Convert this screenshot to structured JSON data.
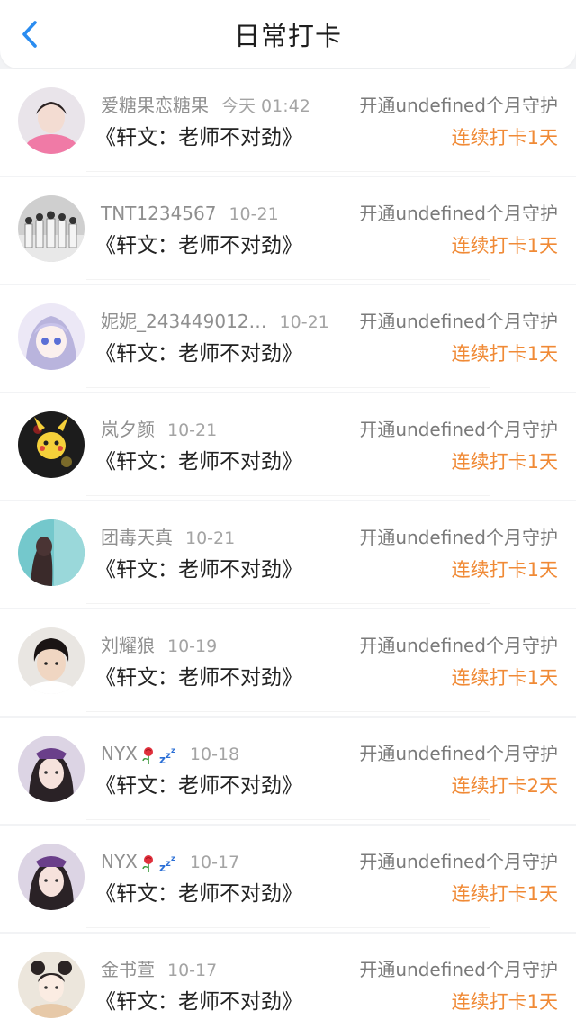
{
  "header": {
    "title": "日常打卡",
    "back_icon": "chevron-left-icon",
    "accent_color": "#2a8cf0"
  },
  "colors": {
    "streak": "#f08a36",
    "muted_text": "#8f8f8f"
  },
  "records": [
    {
      "user": "爱糖果恋糖果",
      "date": "今天 01:42",
      "book": "《轩文：老师不对劲》",
      "subscribe": "开通undefined个月守护",
      "streak": "连续打卡1天",
      "avatar": "avatar-pink",
      "name_icons": []
    },
    {
      "user": "TNT1234567",
      "date": "10-21",
      "book": "《轩文：老师不对劲》",
      "subscribe": "开通undefined个月守护",
      "streak": "连续打卡1天",
      "avatar": "avatar-group",
      "name_icons": []
    },
    {
      "user": "妮妮_243449012…",
      "date": "10-21",
      "book": "《轩文：老师不对劲》",
      "subscribe": "开通undefined个月守护",
      "streak": "连续打卡1天",
      "avatar": "avatar-anime",
      "name_icons": []
    },
    {
      "user": "岚夕颜",
      "date": "10-21",
      "book": "《轩文：老师不对劲》",
      "subscribe": "开通undefined个月守护",
      "streak": "连续打卡1天",
      "avatar": "avatar-pikachu",
      "name_icons": []
    },
    {
      "user": "团毒天真",
      "date": "10-21",
      "book": "《轩文：老师不对劲》",
      "subscribe": "开通undefined个月守护",
      "streak": "连续打卡1天",
      "avatar": "avatar-teal",
      "name_icons": []
    },
    {
      "user": "刘耀狼",
      "date": "10-19",
      "book": "《轩文：老师不对劲》",
      "subscribe": "开通undefined个月守护",
      "streak": "连续打卡1天",
      "avatar": "avatar-boy",
      "name_icons": []
    },
    {
      "user": "NYX",
      "date": "10-18",
      "book": "《轩文：老师不对劲》",
      "subscribe": "开通undefined个月守护",
      "streak": "连续打卡2天",
      "avatar": "avatar-girl-purple",
      "name_icons": [
        "rose-icon",
        "sleep-zzz-icon"
      ]
    },
    {
      "user": "NYX",
      "date": "10-17",
      "book": "《轩文：老师不对劲》",
      "subscribe": "开通undefined个月守护",
      "streak": "连续打卡1天",
      "avatar": "avatar-girl-purple",
      "name_icons": [
        "rose-icon",
        "sleep-zzz-icon"
      ]
    },
    {
      "user": "金书萱",
      "date": "10-17",
      "book": "《轩文：老师不对劲》",
      "subscribe": "开通undefined个月守护",
      "streak": "连续打卡1天",
      "avatar": "avatar-hanfu",
      "name_icons": []
    }
  ]
}
